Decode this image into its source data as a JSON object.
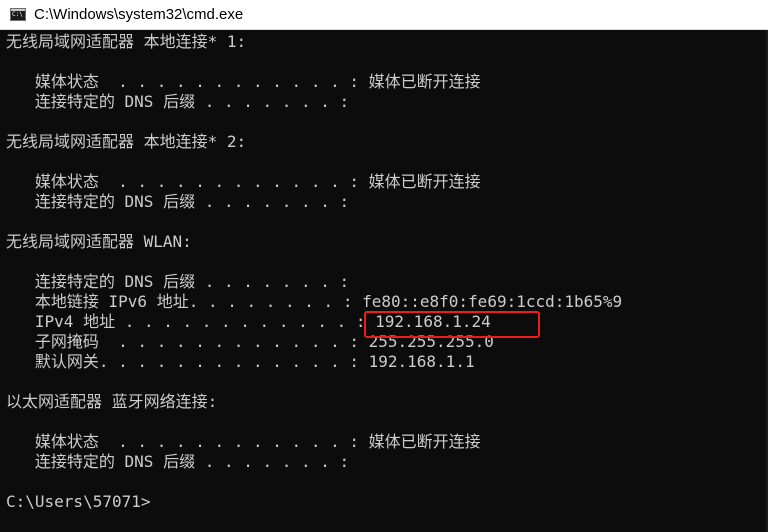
{
  "window": {
    "title": "C:\\Windows\\system32\\cmd.exe",
    "icon": "cmd-console-icon"
  },
  "console": {
    "lines": [
      "无线局域网适配器 本地连接* 1:",
      "",
      "   媒体状态  . . . . . . . . . . . . : 媒体已断开连接",
      "   连接特定的 DNS 后缀 . . . . . . . :",
      "",
      "无线局域网适配器 本地连接* 2:",
      "",
      "   媒体状态  . . . . . . . . . . . . : 媒体已断开连接",
      "   连接特定的 DNS 后缀 . . . . . . . :",
      "",
      "无线局域网适配器 WLAN:",
      "",
      "   连接特定的 DNS 后缀 . . . . . . . :",
      "   本地链接 IPv6 地址. . . . . . . . : fe80::e8f0:fe69:1ccd:1b65%9",
      "   IPv4 地址 . . . . . . . . . . . . : 192.168.1.24",
      "   子网掩码  . . . . . . . . . . . . : 255.255.255.0",
      "   默认网关. . . . . . . . . . . . . : 192.168.1.1",
      "",
      "以太网适配器 蓝牙网络连接:",
      "",
      "   媒体状态  . . . . . . . . . . . . : 媒体已断开连接",
      "   连接特定的 DNS 后缀 . . . . . . . :",
      "",
      "C:\\Users\\57071>"
    ]
  },
  "colors": {
    "console_bg": "#0c0c0c",
    "console_fg": "#cccccc",
    "highlight": "#e8201a",
    "titlebar_bg": "#ffffff"
  }
}
